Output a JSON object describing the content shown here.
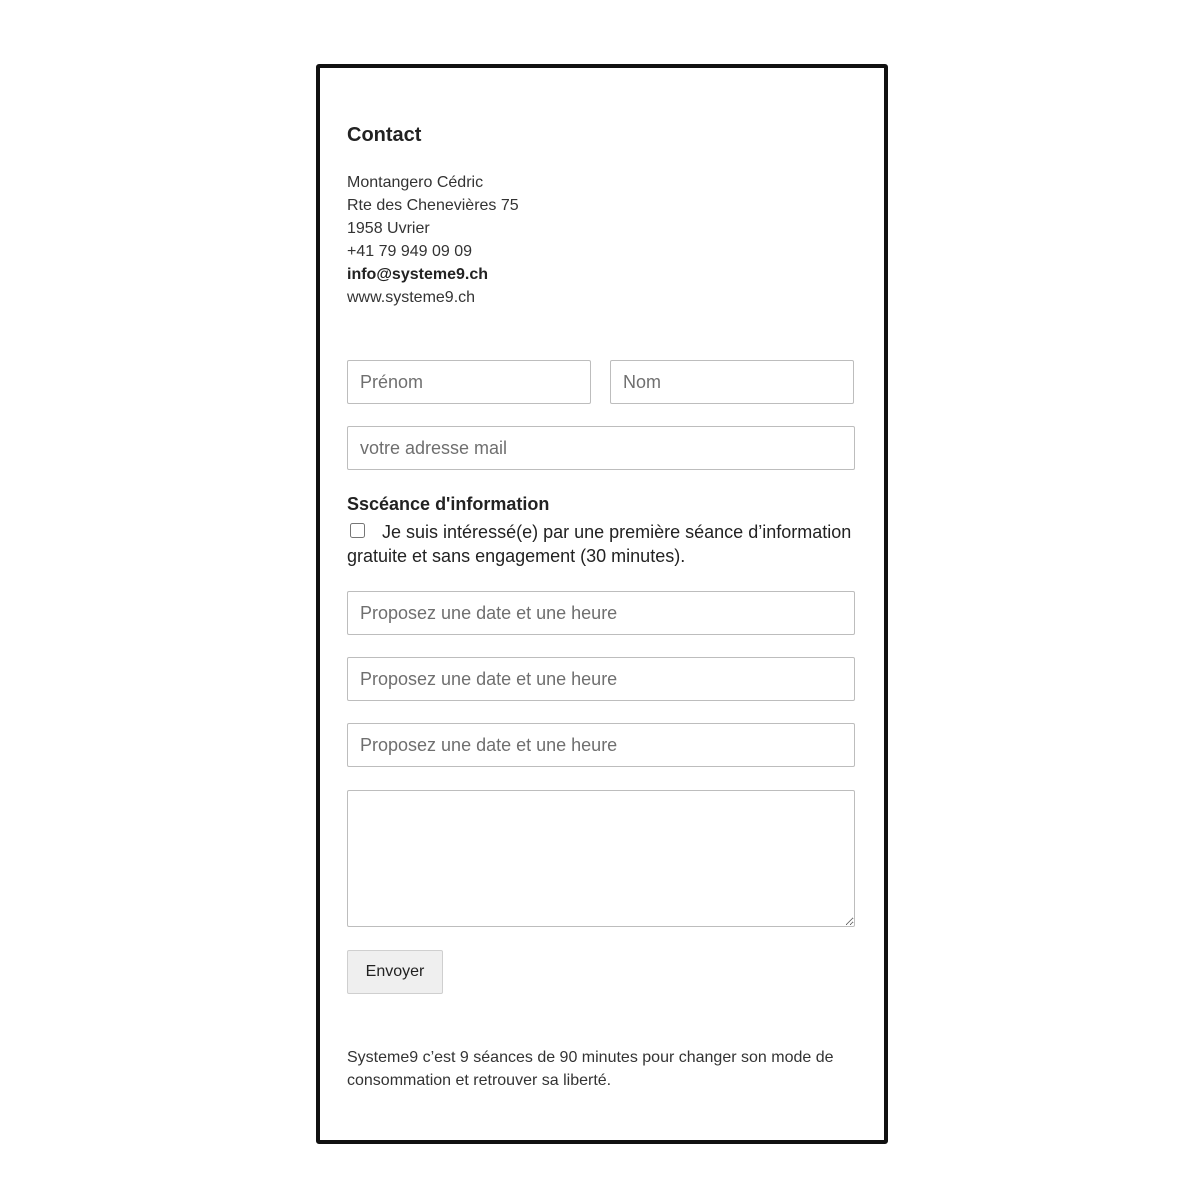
{
  "contact": {
    "title": "Contact",
    "name": "Montangero Cédric",
    "street": "Rte des Chenevières 75",
    "city": "1958 Uvrier",
    "phone": "+41 79 949 09 09",
    "email": "info@systeme9.ch",
    "website": "www.systeme9.ch"
  },
  "form": {
    "first_name_placeholder": "Prénom",
    "last_name_placeholder": "Nom",
    "email_placeholder": "votre adresse mail",
    "session_heading": "Sscéance d'information",
    "consent_label": "Je suis intéressé(e) par une première séance d’information gratuite et sans engagement (30 minutes).",
    "consent_checked": false,
    "date_placeholders": [
      "Proposez une date et une heure",
      "Proposez une date et une heure",
      "Proposez une date et une heure"
    ],
    "message_value": "",
    "submit_label": "Envoyer"
  },
  "footer": {
    "text": "Systeme9 c’est 9 séances de 90 minutes pour changer son mode de consommation et retrouver sa liberté."
  }
}
